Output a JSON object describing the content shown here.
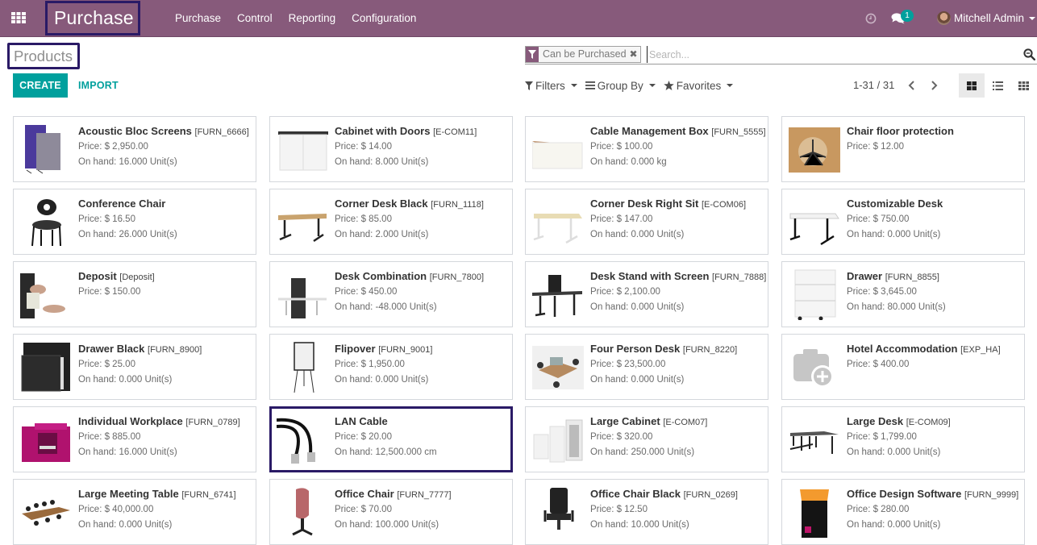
{
  "navbar": {
    "app_name": "Purchase",
    "menu": [
      "Purchase",
      "Control",
      "Reporting",
      "Configuration"
    ],
    "notification_count": "1",
    "user_name": "Mitchell Admin",
    "icons": {
      "apps": "apps-grid-icon",
      "activity": "clock-icon",
      "messages": "chat-icon"
    }
  },
  "control_panel": {
    "title": "Products",
    "create_label": "CREATE",
    "import_label": "IMPORT",
    "search": {
      "facet_label": "Can be Purchased",
      "placeholder": "Search..."
    },
    "filters_label": "Filters",
    "group_by_label": "Group By",
    "favorites_label": "Favorites",
    "pager": "1-31 / 31",
    "views": [
      "kanban",
      "list",
      "grid"
    ],
    "active_view": "kanban"
  },
  "colors": {
    "brand": "#875a7b",
    "accent": "#00a09d",
    "highlight": "#2a1a66"
  },
  "products": [
    {
      "name": "Acoustic Bloc Screens",
      "ref": "[FURN_6666]",
      "price": "Price: $ 2,950.00",
      "onhand": "On hand: 16.000 Unit(s)",
      "thumb": "acoustic-screens"
    },
    {
      "name": "Cabinet with Doors",
      "ref": "[E-COM11]",
      "price": "Price: $ 14.00",
      "onhand": "On hand: 8.000 Unit(s)",
      "thumb": "cabinet"
    },
    {
      "name": "Cable Management Box",
      "ref": "[FURN_5555]",
      "price": "Price: $ 100.00",
      "onhand": "On hand: 0.000 kg",
      "thumb": "box"
    },
    {
      "name": "Chair floor protection",
      "ref": "",
      "price": "Price: $ 12.00",
      "onhand": "",
      "thumb": "floor"
    },
    {
      "name": "Conference Chair",
      "ref": "",
      "price": "Price: $ 16.50",
      "onhand": "On hand: 26.000 Unit(s)",
      "thumb": "chair-black"
    },
    {
      "name": "Corner Desk Black",
      "ref": "[FURN_1118]",
      "price": "Price: $ 85.00",
      "onhand": "On hand: 2.000 Unit(s)",
      "thumb": "desk-wood"
    },
    {
      "name": "Corner Desk Right Sit",
      "ref": "[E-COM06]",
      "price": "Price: $ 147.00",
      "onhand": "On hand: 0.000 Unit(s)",
      "thumb": "desk-beige"
    },
    {
      "name": "Customizable Desk",
      "ref": "",
      "price": "Price: $ 750.00",
      "onhand": "On hand: 0.000 Unit(s)",
      "thumb": "desk-white"
    },
    {
      "name": "Deposit",
      "ref": "[Deposit]",
      "price": "Price: $ 150.00",
      "onhand": "",
      "thumb": "money"
    },
    {
      "name": "Desk Combination",
      "ref": "[FURN_7800]",
      "price": "Price: $ 450.00",
      "onhand": "On hand: -48.000 Unit(s)",
      "thumb": "desk-combo"
    },
    {
      "name": "Desk Stand with Screen",
      "ref": "[FURN_7888]",
      "price": "Price: $ 2,100.00",
      "onhand": "On hand: 0.000 Unit(s)",
      "thumb": "desk-screen"
    },
    {
      "name": "Drawer",
      "ref": "[FURN_8855]",
      "price": "Price: $ 3,645.00",
      "onhand": "On hand: 80.000 Unit(s)",
      "thumb": "drawer-white"
    },
    {
      "name": "Drawer Black",
      "ref": "[FURN_8900]",
      "price": "Price: $ 25.00",
      "onhand": "On hand: 0.000 Unit(s)",
      "thumb": "drawer-black"
    },
    {
      "name": "Flipover",
      "ref": "[FURN_9001]",
      "price": "Price: $ 1,950.00",
      "onhand": "On hand: 0.000 Unit(s)",
      "thumb": "flipover"
    },
    {
      "name": "Four Person Desk",
      "ref": "[FURN_8220]",
      "price": "Price: $ 23,500.00",
      "onhand": "On hand: 0.000 Unit(s)",
      "thumb": "four-desk"
    },
    {
      "name": "Hotel Accommodation",
      "ref": "[EXP_HA]",
      "price": "Price: $ 400.00",
      "onhand": "",
      "thumb": "placeholder-camera"
    },
    {
      "name": "Individual Workplace",
      "ref": "[FURN_0789]",
      "price": "Price: $ 885.00",
      "onhand": "On hand: 16.000 Unit(s)",
      "thumb": "workplace"
    },
    {
      "name": "LAN Cable",
      "ref": "",
      "price": "Price: $ 20.00",
      "onhand": "On hand: 12,500.000 cm",
      "thumb": "cable",
      "selected": true
    },
    {
      "name": "Large Cabinet",
      "ref": "[E-COM07]",
      "price": "Price: $ 320.00",
      "onhand": "On hand: 250.000 Unit(s)",
      "thumb": "large-cabinet"
    },
    {
      "name": "Large Desk",
      "ref": "[E-COM09]",
      "price": "Price: $ 1,799.00",
      "onhand": "On hand: 0.000 Unit(s)",
      "thumb": "large-desk"
    },
    {
      "name": "Large Meeting Table",
      "ref": "[FURN_6741]",
      "price": "Price: $ 40,000.00",
      "onhand": "On hand: 0.000 Unit(s)",
      "thumb": "meeting-table"
    },
    {
      "name": "Office Chair",
      "ref": "[FURN_7777]",
      "price": "Price: $ 70.00",
      "onhand": "On hand: 100.000 Unit(s)",
      "thumb": "chair-pink"
    },
    {
      "name": "Office Chair Black",
      "ref": "[FURN_0269]",
      "price": "Price: $ 12.50",
      "onhand": "On hand: 10.000 Unit(s)",
      "thumb": "chair-office"
    },
    {
      "name": "Office Design Software",
      "ref": "[FURN_9999]",
      "price": "Price: $ 280.00",
      "onhand": "On hand: 0.000 Unit(s)",
      "thumb": "software-box"
    }
  ]
}
